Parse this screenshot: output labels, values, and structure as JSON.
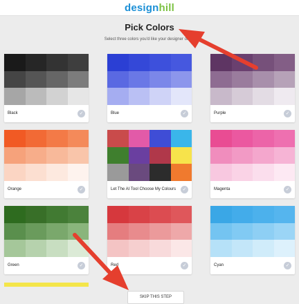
{
  "header": {
    "logo_part1": "design",
    "logo_part2": "hill",
    "title": "Pick Colors",
    "subtitle": "Select three colors you'd like your designer        olors."
  },
  "colors": {
    "logo_blue": "#1b8fd6",
    "logo_green": "#7cc242",
    "arrow": "#e53f2e"
  },
  "cards": [
    {
      "label": "Black",
      "selected": false,
      "swatches": [
        "#1a1a1a",
        "#262626",
        "#333333",
        "#3e3e3e",
        "#454545",
        "#555555",
        "#666666",
        "#7c7c7c",
        "#a6a6a6",
        "#bbbbbb",
        "#d2d2d2",
        "#e6e6e6"
      ]
    },
    {
      "label": "Blue",
      "selected": false,
      "swatches": [
        "#2b3fd4",
        "#3448d8",
        "#3d50dc",
        "#4658df",
        "#5a69e2",
        "#6a78e6",
        "#7b87e9",
        "#8c96ec",
        "#a5adf1",
        "#bac0f4",
        "#cfd3f7",
        "#e3e6fa"
      ]
    },
    {
      "label": "Purple",
      "selected": false,
      "swatches": [
        "#5e3563",
        "#6a406f",
        "#76507a",
        "#835e86",
        "#8e6c92",
        "#9a7c9d",
        "#a88fab",
        "#b6a2b8",
        "#c8b9ca",
        "#d6cbd7",
        "#e3dce4",
        "#efeaf0"
      ]
    },
    {
      "label": "Orange",
      "selected": false,
      "swatches": [
        "#f15a24",
        "#f26a35",
        "#f37a47",
        "#f48a5a",
        "#f6a27b",
        "#f7ad8a",
        "#f8b99a",
        "#f9c5aa",
        "#fbd5c3",
        "#fcdfd1",
        "#fde9df",
        "#fef3ee"
      ]
    },
    {
      "label": "Let The AI Tool Choose My Colours",
      "selected": false,
      "swatches": [
        "#c94b4b",
        "#e25aa8",
        "#3f4dd6",
        "#3ab6ea",
        "#3f7f2e",
        "#6a3fa0",
        "#b0384a",
        "#f7e34b",
        "#9a9a9a",
        "#6a4a7e",
        "#2c2c2c",
        "#f07a2e"
      ]
    },
    {
      "label": "Magenta",
      "selected": false,
      "swatches": [
        "#e94c93",
        "#eb58a0",
        "#ec64a8",
        "#ee70b0",
        "#f08dbd",
        "#f29ac5",
        "#f4a7cd",
        "#f6b4d5",
        "#f8c8e0",
        "#fad3e6",
        "#fbdeed",
        "#fde9f3"
      ]
    },
    {
      "label": "Green",
      "selected": false,
      "swatches": [
        "#2e6b1f",
        "#386f28",
        "#417a32",
        "#4b823c",
        "#5a8f4d",
        "#6a9b5c",
        "#7aa86c",
        "#8ab57c",
        "#a5c79a",
        "#b6d2ad",
        "#c8dec1",
        "#dbead6"
      ]
    },
    {
      "label": "Red",
      "selected": false,
      "swatches": [
        "#d6383d",
        "#d94247",
        "#dc4c51",
        "#df575b",
        "#e57d7f",
        "#e88b8d",
        "#eb9a9b",
        "#eea8a9",
        "#f4c4c4",
        "#f6cfcf",
        "#f8dadb",
        "#fbe7e7"
      ]
    },
    {
      "label": "Cyan",
      "selected": false,
      "swatches": [
        "#3aa7e6",
        "#43acea",
        "#4cb1ec",
        "#55b5ee",
        "#74c4f1",
        "#81caf3",
        "#8ecff4",
        "#9bd5f6",
        "#b6e1f8",
        "#c3e6f9",
        "#d0ecfa",
        "#ddf1fc"
      ]
    }
  ],
  "footer": {
    "skip_label": "SKIP THIS STEP"
  }
}
